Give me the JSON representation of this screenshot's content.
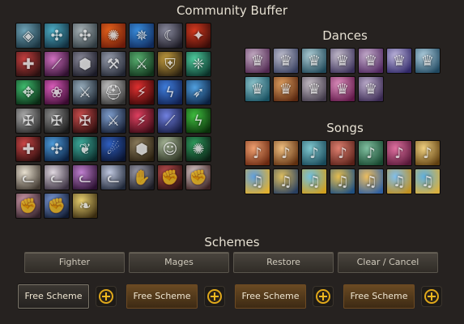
{
  "window": {
    "title": "Community Buffer"
  },
  "buffs": [
    {
      "name": "rune-circle-icon",
      "c1": "#6fa4b8",
      "c2": "#1b3440",
      "g": "◈"
    },
    {
      "name": "teal-wheel-icon",
      "c1": "#4fb0c8",
      "c2": "#123040",
      "g": "✣"
    },
    {
      "name": "grey-wheel-icon",
      "c1": "#a9b4b8",
      "c2": "#2f3a40",
      "g": "✣"
    },
    {
      "name": "fire-swirl-icon",
      "c1": "#e8641c",
      "c2": "#6a1a0a",
      "g": "✺"
    },
    {
      "name": "blue-flame-icon",
      "c1": "#3a8fe0",
      "c2": "#102a5a",
      "g": "✵"
    },
    {
      "name": "dark-lady-icon",
      "c1": "#8b8ca0",
      "c2": "#1c1a24",
      "g": "☾"
    },
    {
      "name": "red-rune-icon",
      "c1": "#d43a20",
      "c2": "#3a0c08",
      "g": "✦"
    },
    {
      "name": "red-armor-icon",
      "c1": "#c84040",
      "c2": "#2a1010",
      "g": "✚"
    },
    {
      "name": "pink-slash-icon",
      "c1": "#d070c0",
      "c2": "#301030",
      "g": "⟋"
    },
    {
      "name": "grey-shield-icon",
      "c1": "#8a8a9a",
      "c2": "#1a1a26",
      "g": "⬢"
    },
    {
      "name": "hammer-icon",
      "c1": "#9aa0b0",
      "c2": "#202430",
      "g": "⚒"
    },
    {
      "name": "green-warrior-icon",
      "c1": "#58b070",
      "c2": "#10301a",
      "g": "⚔"
    },
    {
      "name": "gold-shield-icon",
      "c1": "#c8a040",
      "c2": "#2a2010",
      "g": "⛨"
    },
    {
      "name": "green-crest-icon",
      "c1": "#50d0a0",
      "c2": "#0a3028",
      "g": "❈"
    },
    {
      "name": "feather-icon",
      "c1": "#40c070",
      "c2": "#0a2a14",
      "g": "✥"
    },
    {
      "name": "pink-flower-icon",
      "c1": "#e060c0",
      "c2": "#3a0a30",
      "g": "❀"
    },
    {
      "name": "grey-sword-icon",
      "c1": "#9ab0c0",
      "c2": "#18202a",
      "g": "⚔"
    },
    {
      "name": "helmet-icon",
      "c1": "#d0d0d0",
      "c2": "#303030",
      "g": "⛑"
    },
    {
      "name": "red-blade-icon",
      "c1": "#e03030",
      "c2": "#3a0808",
      "g": "⚡"
    },
    {
      "name": "blue-lightning-icon",
      "c1": "#4080e0",
      "c2": "#102050",
      "g": "ϟ"
    },
    {
      "name": "blue-arrow-icon",
      "c1": "#50a0e0",
      "c2": "#0a2040",
      "g": "➶"
    },
    {
      "name": "silver-cross-icon",
      "c1": "#b0b0b0",
      "c2": "#282828",
      "g": "✠"
    },
    {
      "name": "dark-cross-icon",
      "c1": "#909090",
      "c2": "#1a1a1a",
      "g": "✠"
    },
    {
      "name": "red-cross-icon",
      "c1": "#d05050",
      "c2": "#2a0c0c",
      "g": "✠"
    },
    {
      "name": "sword-strike-icon",
      "c1": "#80a0d0",
      "c2": "#141c30",
      "g": "⚔"
    },
    {
      "name": "red-strike-icon",
      "c1": "#e04060",
      "c2": "#3a0a14",
      "g": "⚡"
    },
    {
      "name": "purple-beam-icon",
      "c1": "#7080e0",
      "c2": "#141a40",
      "g": "⟋"
    },
    {
      "name": "green-claw-icon",
      "c1": "#40c040",
      "c2": "#0a300a",
      "g": "ϟ"
    },
    {
      "name": "red-totem-icon",
      "c1": "#d04848",
      "c2": "#2a0c0c",
      "g": "✚"
    },
    {
      "name": "blue-wheel-icon",
      "c1": "#50a0e0",
      "c2": "#0a2040",
      "g": "✣"
    },
    {
      "name": "teal-feather-icon",
      "c1": "#40b0a0",
      "c2": "#0a2a28",
      "g": "❦"
    },
    {
      "name": "blue-tendril-icon",
      "c1": "#3060c0",
      "c2": "#0a1430",
      "g": "☄"
    },
    {
      "name": "turtle-shell-icon",
      "c1": "#908060",
      "c2": "#2a2010",
      "g": "⬢"
    },
    {
      "name": "green-spirit-icon",
      "c1": "#b0c0a0",
      "c2": "#2a3020",
      "g": "☺"
    },
    {
      "name": "green-swirl-icon",
      "c1": "#30a060",
      "c2": "#0a2014",
      "g": "✺"
    },
    {
      "name": "white-cat-icon",
      "c1": "#e8e0d0",
      "c2": "#403830",
      "g": "ᓚ"
    },
    {
      "name": "white-beast-icon",
      "c1": "#e0d8e0",
      "c2": "#3a3040",
      "g": "ᓚ"
    },
    {
      "name": "purple-wolf-icon",
      "c1": "#c080d0",
      "c2": "#2a1030",
      "g": "ᓚ"
    },
    {
      "name": "white-wolf-icon",
      "c1": "#c0c8e0",
      "c2": "#202838",
      "g": "ᓚ"
    },
    {
      "name": "grey-claw-icon",
      "c1": "#a0a0b0",
      "c2": "#1c1c24",
      "g": "✋"
    },
    {
      "name": "red-gauntlet-icon",
      "c1": "#c05050",
      "c2": "#2a1010",
      "g": "✊"
    },
    {
      "name": "white-fist-icon",
      "c1": "#e0d0d0",
      "c2": "#3a2020",
      "g": "✊"
    },
    {
      "name": "pink-fist-icon",
      "c1": "#d8a0b0",
      "c2": "#302028",
      "g": "✊"
    },
    {
      "name": "blue-fist-icon",
      "c1": "#80a0e0",
      "c2": "#101a30",
      "g": "✊"
    },
    {
      "name": "golden-wing-icon",
      "c1": "#e8d070",
      "c2": "#3a2c10",
      "g": "❧"
    }
  ],
  "dances": {
    "title": "Dances",
    "items": [
      {
        "name": "dance-icon",
        "c1": "#c8b0c8",
        "c2": "#502850",
        "g": "♛"
      },
      {
        "name": "dance-icon",
        "c1": "#c0c0d0",
        "c2": "#384060",
        "g": "♛"
      },
      {
        "name": "dance-icon",
        "c1": "#b0d0d8",
        "c2": "#204858",
        "g": "♛"
      },
      {
        "name": "dance-icon",
        "c1": "#c8c0d0",
        "c2": "#3a3058",
        "g": "♛"
      },
      {
        "name": "dance-icon",
        "c1": "#c8b0d0",
        "c2": "#502860",
        "g": "♛"
      },
      {
        "name": "dance-icon",
        "c1": "#c0b8e0",
        "c2": "#302868",
        "g": "♛"
      },
      {
        "name": "dance-icon",
        "c1": "#b0d0e0",
        "c2": "#204860",
        "g": "♛"
      },
      {
        "name": "dance-icon",
        "c1": "#90c8d0",
        "c2": "#185060",
        "g": "♛"
      },
      {
        "name": "dance-icon",
        "c1": "#e0a060",
        "c2": "#5a2810",
        "g": "♛"
      },
      {
        "name": "dance-icon",
        "c1": "#c8c0c8",
        "c2": "#403848",
        "g": "♛"
      },
      {
        "name": "dance-icon",
        "c1": "#e090c0",
        "c2": "#601848",
        "g": "♛"
      },
      {
        "name": "dance-icon",
        "c1": "#c0b0d0",
        "c2": "#382850",
        "g": "♛"
      }
    ]
  },
  "songs": {
    "title": "Songs",
    "items": [
      {
        "name": "song-icon",
        "c1": "#f0a070",
        "c2": "#6a2810",
        "g": "♪"
      },
      {
        "name": "song-icon",
        "c1": "#f0c080",
        "c2": "#603010",
        "g": "♪"
      },
      {
        "name": "song-icon",
        "c1": "#80c8d0",
        "c2": "#184858",
        "g": "♪"
      },
      {
        "name": "song-icon",
        "c1": "#e08070",
        "c2": "#582018",
        "g": "♪"
      },
      {
        "name": "song-icon",
        "c1": "#80c0a0",
        "c2": "#184830",
        "g": "♪"
      },
      {
        "name": "song-icon",
        "c1": "#e070a0",
        "c2": "#581838",
        "g": "♪"
      },
      {
        "name": "song-icon",
        "c1": "#f0d080",
        "c2": "#604010",
        "g": "♪"
      },
      {
        "name": "song-icon",
        "c1": "#60a0e0",
        "c2": "#e0b030",
        "g": "♫"
      },
      {
        "name": "song-icon",
        "c1": "#e0c060",
        "c2": "#2a4060",
        "g": "♫"
      },
      {
        "name": "song-icon",
        "c1": "#70c0e0",
        "c2": "#d0a020",
        "g": "♫"
      },
      {
        "name": "song-icon",
        "c1": "#e8c050",
        "c2": "#205080",
        "g": "♫"
      },
      {
        "name": "song-icon",
        "c1": "#f0c060",
        "c2": "#3060a0",
        "g": "♫"
      },
      {
        "name": "song-icon",
        "c1": "#80c0f0",
        "c2": "#c09020",
        "g": "♫"
      },
      {
        "name": "song-icon",
        "c1": "#60b0e0",
        "c2": "#d8b040",
        "g": "♫"
      }
    ]
  },
  "schemes": {
    "title": "Schemes",
    "buttons": [
      "Fighter",
      "Mages",
      "Restore",
      "Clear / Cancel"
    ],
    "slots": [
      "Free Scheme",
      "Free Scheme",
      "Free Scheme",
      "Free Scheme"
    ]
  }
}
